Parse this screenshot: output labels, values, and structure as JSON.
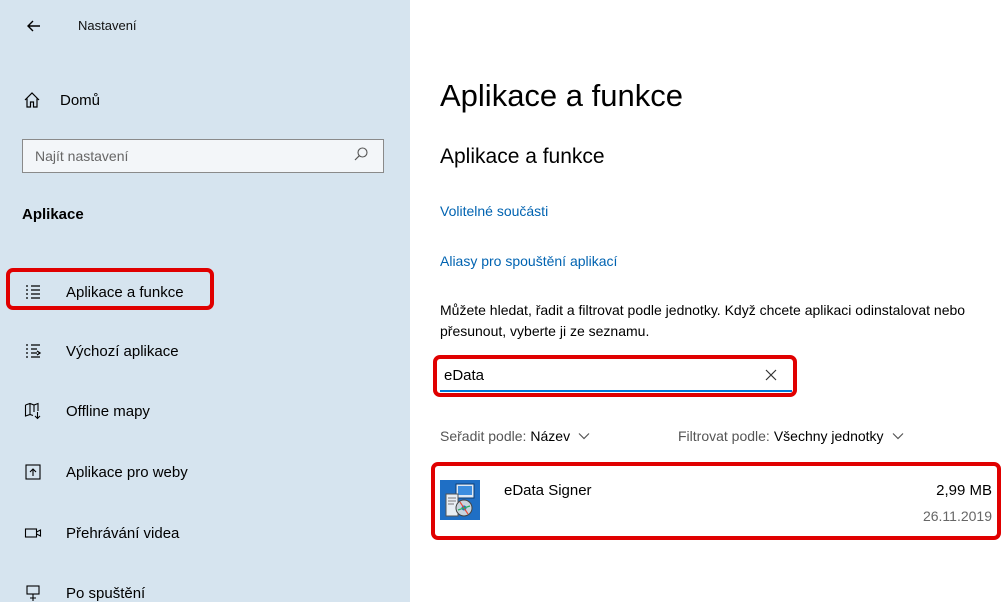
{
  "window": {
    "title": "Nastavení"
  },
  "sidebar": {
    "home_label": "Domů",
    "search": {
      "placeholder": "Najít nastavení"
    },
    "section": "Aplikace",
    "items": [
      {
        "label": "Aplikace a funkce",
        "icon": "apps-list-icon",
        "selected": true
      },
      {
        "label": "Výchozí aplikace",
        "icon": "default-apps-icon"
      },
      {
        "label": "Offline mapy",
        "icon": "offline-map-icon"
      },
      {
        "label": "Aplikace pro weby",
        "icon": "web-apps-icon"
      },
      {
        "label": "Přehrávání videa",
        "icon": "video-playback-icon"
      },
      {
        "label": "Po spuštění",
        "icon": "startup-icon"
      }
    ]
  },
  "main": {
    "page_title": "Aplikace a funkce",
    "section_title": "Aplikace a funkce",
    "links": [
      "Volitelné součásti",
      "Aliasy pro spouštění aplikací"
    ],
    "description": "Můžete hledat, řadit a filtrovat podle jednotky. Když chcete aplikaci odinstalovat nebo přesunout, vyberte ji ze seznamu.",
    "search_value": "eData",
    "sort_label": "Seřadit podle:",
    "sort_value": "Název",
    "filter_label": "Filtrovat podle:",
    "filter_value": "Všechny jednotky",
    "apps": [
      {
        "name": "eData Signer",
        "size": "2,99 MB",
        "date": "26.11.2019"
      }
    ]
  },
  "highlight_color": "#e00000",
  "accent_color": "#0078d7",
  "link_color": "#0063b1"
}
